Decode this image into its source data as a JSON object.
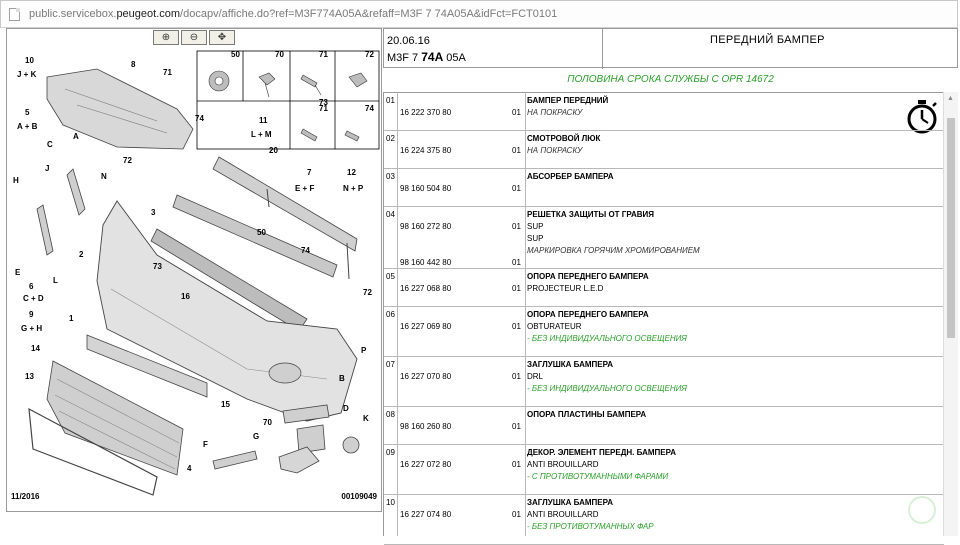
{
  "browser": {
    "url_prefix": "public.servicebox.",
    "url_host": "peugeot.com",
    "url_rest": "/docapv/affiche.do?ref=M3F774A05A&refaff=M3F 7 74A05A&idFct=FCT0101"
  },
  "diagram": {
    "labels": [
      "10",
      "J + K",
      "8",
      "71",
      "5",
      "A + B",
      "74",
      "50",
      "70",
      "71",
      "72",
      "71",
      "73",
      "74",
      "11",
      "L + M",
      "20",
      "7",
      "E + F",
      "12",
      "N + P",
      "A",
      "C",
      "H",
      "J",
      "N",
      "72",
      "F",
      "E",
      "6",
      "C + D",
      "9",
      "G + H",
      "3",
      "2",
      "50",
      "74",
      "73",
      "16",
      "1",
      "14",
      "72",
      "P",
      "13",
      "15",
      "70",
      "B",
      "D",
      "K",
      "G",
      "F",
      "4",
      "L"
    ],
    "footer_left": "11/2016",
    "footer_right": "00109049"
  },
  "zoom_buttons": [
    "zoom-in",
    "zoom-out",
    "zoom-fit"
  ],
  "header": {
    "date": "20.06.16",
    "code_prefix": "M3F 7 ",
    "code_bold": "74A",
    "code_suffix": " 05A",
    "title": "ПЕРЕДНИЙ БАМПЕР"
  },
  "service_note": "ПОЛОВИНА СРОКА СЛУЖБЫ С OPR 14672",
  "rows": [
    {
      "num": "01",
      "refs": [
        {
          "ref": "16 222 370 80",
          "qty": "01"
        }
      ],
      "lines": [
        {
          "t": "title",
          "v": "БАМПЕР ПЕРЕДНИЙ"
        },
        {
          "t": "ital",
          "v": "НА ПОКРАСКУ"
        }
      ]
    },
    {
      "num": "02",
      "refs": [
        {
          "ref": "16 224 375 80",
          "qty": "01"
        }
      ],
      "lines": [
        {
          "t": "title",
          "v": "СМОТРОВОЙ ЛЮК"
        },
        {
          "t": "ital",
          "v": "НА ПОКРАСКУ"
        }
      ]
    },
    {
      "num": "03",
      "refs": [
        {
          "ref": "98 160 504 80",
          "qty": "01"
        }
      ],
      "lines": [
        {
          "t": "title",
          "v": "АБСОРБЕР БАМПЕРА"
        }
      ]
    },
    {
      "num": "04",
      "refs": [
        {
          "ref": "98 160 272 80",
          "qty": "01"
        },
        {
          "ref": "98 160 442 80",
          "qty": "01"
        }
      ],
      "lines": [
        {
          "t": "title",
          "v": "РЕШЕТКА ЗАЩИТЫ ОТ ГРАВИЯ"
        },
        {
          "t": "line",
          "v": "SUP"
        },
        {
          "t": "line",
          "v": "SUP"
        },
        {
          "t": "ital",
          "v": "МАРКИРОВКА ГОРЯЧИМ ХРОМИРОВАНИЕМ"
        }
      ]
    },
    {
      "num": "05",
      "refs": [
        {
          "ref": "16 227 068 80",
          "qty": "01"
        }
      ],
      "lines": [
        {
          "t": "title",
          "v": "ОПОРА ПЕРЕДНЕГО БАМПЕРА"
        },
        {
          "t": "line",
          "v": "PROJECTEUR L.E.D"
        }
      ]
    },
    {
      "num": "06",
      "refs": [
        {
          "ref": "16 227 069 80",
          "qty": "01"
        }
      ],
      "lines": [
        {
          "t": "title",
          "v": "ОПОРА ПЕРЕДНЕГО БАМПЕРА"
        },
        {
          "t": "line",
          "v": "OBTURATEUR"
        },
        {
          "t": "green",
          "v": "- БЕЗ ИНДИВИДУАЛЬНОГО ОСВЕЩЕНИЯ"
        }
      ]
    },
    {
      "num": "07",
      "refs": [
        {
          "ref": "16 227 070 80",
          "qty": "01"
        }
      ],
      "lines": [
        {
          "t": "title",
          "v": "ЗАГЛУШКА БАМПЕРА"
        },
        {
          "t": "line",
          "v": "DRL"
        },
        {
          "t": "green",
          "v": "- БЕЗ ИНДИВИДУАЛЬНОГО ОСВЕЩЕНИЯ"
        }
      ]
    },
    {
      "num": "08",
      "refs": [
        {
          "ref": "98 160 260 80",
          "qty": "01"
        }
      ],
      "lines": [
        {
          "t": "title",
          "v": "ОПОРА ПЛАСТИНЫ БАМПЕРА"
        }
      ]
    },
    {
      "num": "09",
      "refs": [
        {
          "ref": "16 227 072 80",
          "qty": "01"
        }
      ],
      "lines": [
        {
          "t": "title",
          "v": "ДЕКОР. ЭЛЕМЕНТ ПЕРЕДН. БАМПЕРА"
        },
        {
          "t": "line",
          "v": "ANTI BROUILLARD"
        },
        {
          "t": "green",
          "v": "- С ПРОТИВОТУМАННЫМИ ФАРАМИ"
        }
      ]
    },
    {
      "num": "10",
      "refs": [
        {
          "ref": "16 227 074 80",
          "qty": "01"
        }
      ],
      "lines": [
        {
          "t": "title",
          "v": "ЗАГЛУШКА БАМПЕРА"
        },
        {
          "t": "line",
          "v": "ANTI BROUILLARD"
        },
        {
          "t": "green",
          "v": "- БЕЗ ПРОТИВОТУМАННЫХ ФАР"
        }
      ]
    }
  ],
  "icons": {
    "stopwatch": "stopwatch-icon",
    "watermark": "checkmark-watermark-icon"
  }
}
